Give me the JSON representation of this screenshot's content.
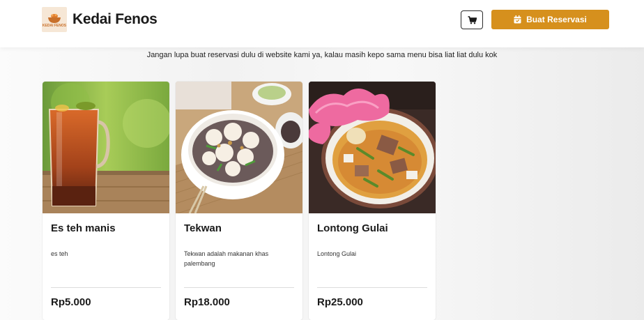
{
  "header": {
    "brand": "Kedai Fenos",
    "logo_text": "KEDAI FENOS",
    "reserve_label": "Buat Reservasi",
    "cart_icon": "cart-icon",
    "calendar_icon": "calendar-icon"
  },
  "notice": "Jangan lupa buat reservasi dulu di website kami ya, kalau masih kepo sama menu bisa liat liat dulu kok",
  "menu": [
    {
      "name": "Es teh manis",
      "description": "es teh",
      "price": "Rp5.000"
    },
    {
      "name": "Tekwan",
      "description": "Tekwan adalah makanan khas palembang",
      "price": "Rp18.000"
    },
    {
      "name": "Lontong Gulai",
      "description": "Lontong Gulai",
      "price": "Rp25.000"
    }
  ],
  "colors": {
    "accent": "#d6901d",
    "text": "#1a1a1a",
    "logo_bg": "#f6e7d6"
  }
}
